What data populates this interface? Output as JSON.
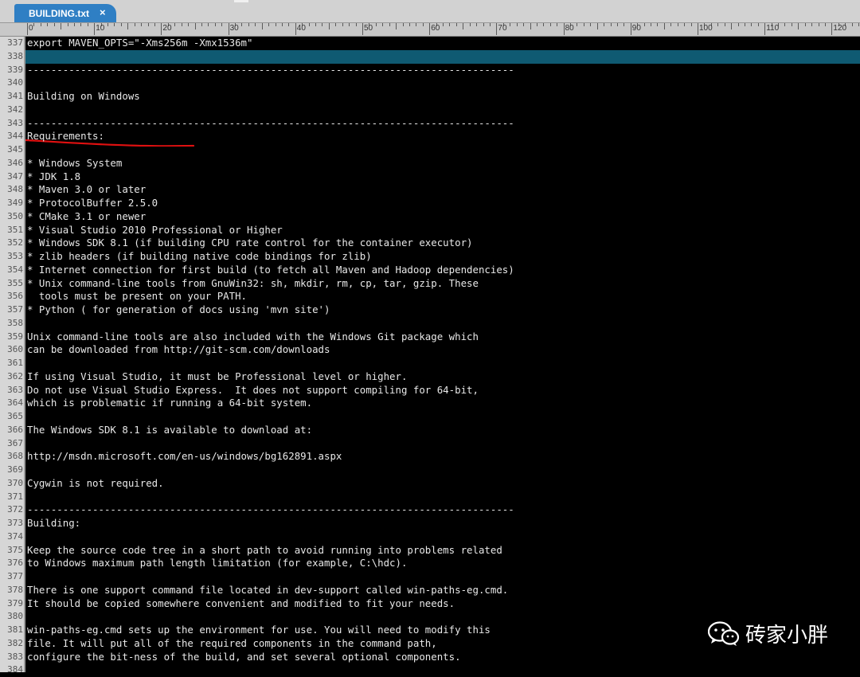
{
  "tab": {
    "title": "BUILDING.txt",
    "close_label": "×"
  },
  "ruler": {
    "labels": [
      "0",
      "10",
      "20",
      "30",
      "40",
      "50",
      "60",
      "70",
      "80",
      "90",
      "100",
      "110",
      "120"
    ]
  },
  "editor": {
    "first_line": 337,
    "highlighted_line": 338,
    "lines": [
      "export MAVEN_OPTS=\"-Xms256m -Xmx1536m\"",
      "",
      "----------------------------------------------------------------------------------",
      "",
      "Building on Windows",
      "",
      "----------------------------------------------------------------------------------",
      "Requirements:",
      "",
      "* Windows System",
      "* JDK 1.8",
      "* Maven 3.0 or later",
      "* ProtocolBuffer 2.5.0",
      "* CMake 3.1 or newer",
      "* Visual Studio 2010 Professional or Higher",
      "* Windows SDK 8.1 (if building CPU rate control for the container executor)",
      "* zlib headers (if building native code bindings for zlib)",
      "* Internet connection for first build (to fetch all Maven and Hadoop dependencies)",
      "* Unix command-line tools from GnuWin32: sh, mkdir, rm, cp, tar, gzip. These",
      "  tools must be present on your PATH.",
      "* Python ( for generation of docs using 'mvn site')",
      "",
      "Unix command-line tools are also included with the Windows Git package which",
      "can be downloaded from http://git-scm.com/downloads",
      "",
      "If using Visual Studio, it must be Professional level or higher.",
      "Do not use Visual Studio Express.  It does not support compiling for 64-bit,",
      "which is problematic if running a 64-bit system.",
      "",
      "The Windows SDK 8.1 is available to download at:",
      "",
      "http://msdn.microsoft.com/en-us/windows/bg162891.aspx",
      "",
      "Cygwin is not required.",
      "",
      "----------------------------------------------------------------------------------",
      "Building:",
      "",
      "Keep the source code tree in a short path to avoid running into problems related",
      "to Windows maximum path length limitation (for example, C:\\hdc).",
      "",
      "There is one support command file located in dev-support called win-paths-eg.cmd.",
      "It should be copied somewhere convenient and modified to fit your needs.",
      "",
      "win-paths-eg.cmd sets up the environment for use. You will need to modify this",
      "file. It will put all of the required components in the command path,",
      "configure the bit-ness of the build, and set several optional components.",
      ""
    ]
  },
  "watermark": {
    "text": "砖家小胖",
    "icon": "wechat-icon"
  },
  "colors": {
    "tab": "#2f7fc4",
    "highlight": "#0f5a72",
    "annotation": "#e01010",
    "background": "#000000"
  }
}
